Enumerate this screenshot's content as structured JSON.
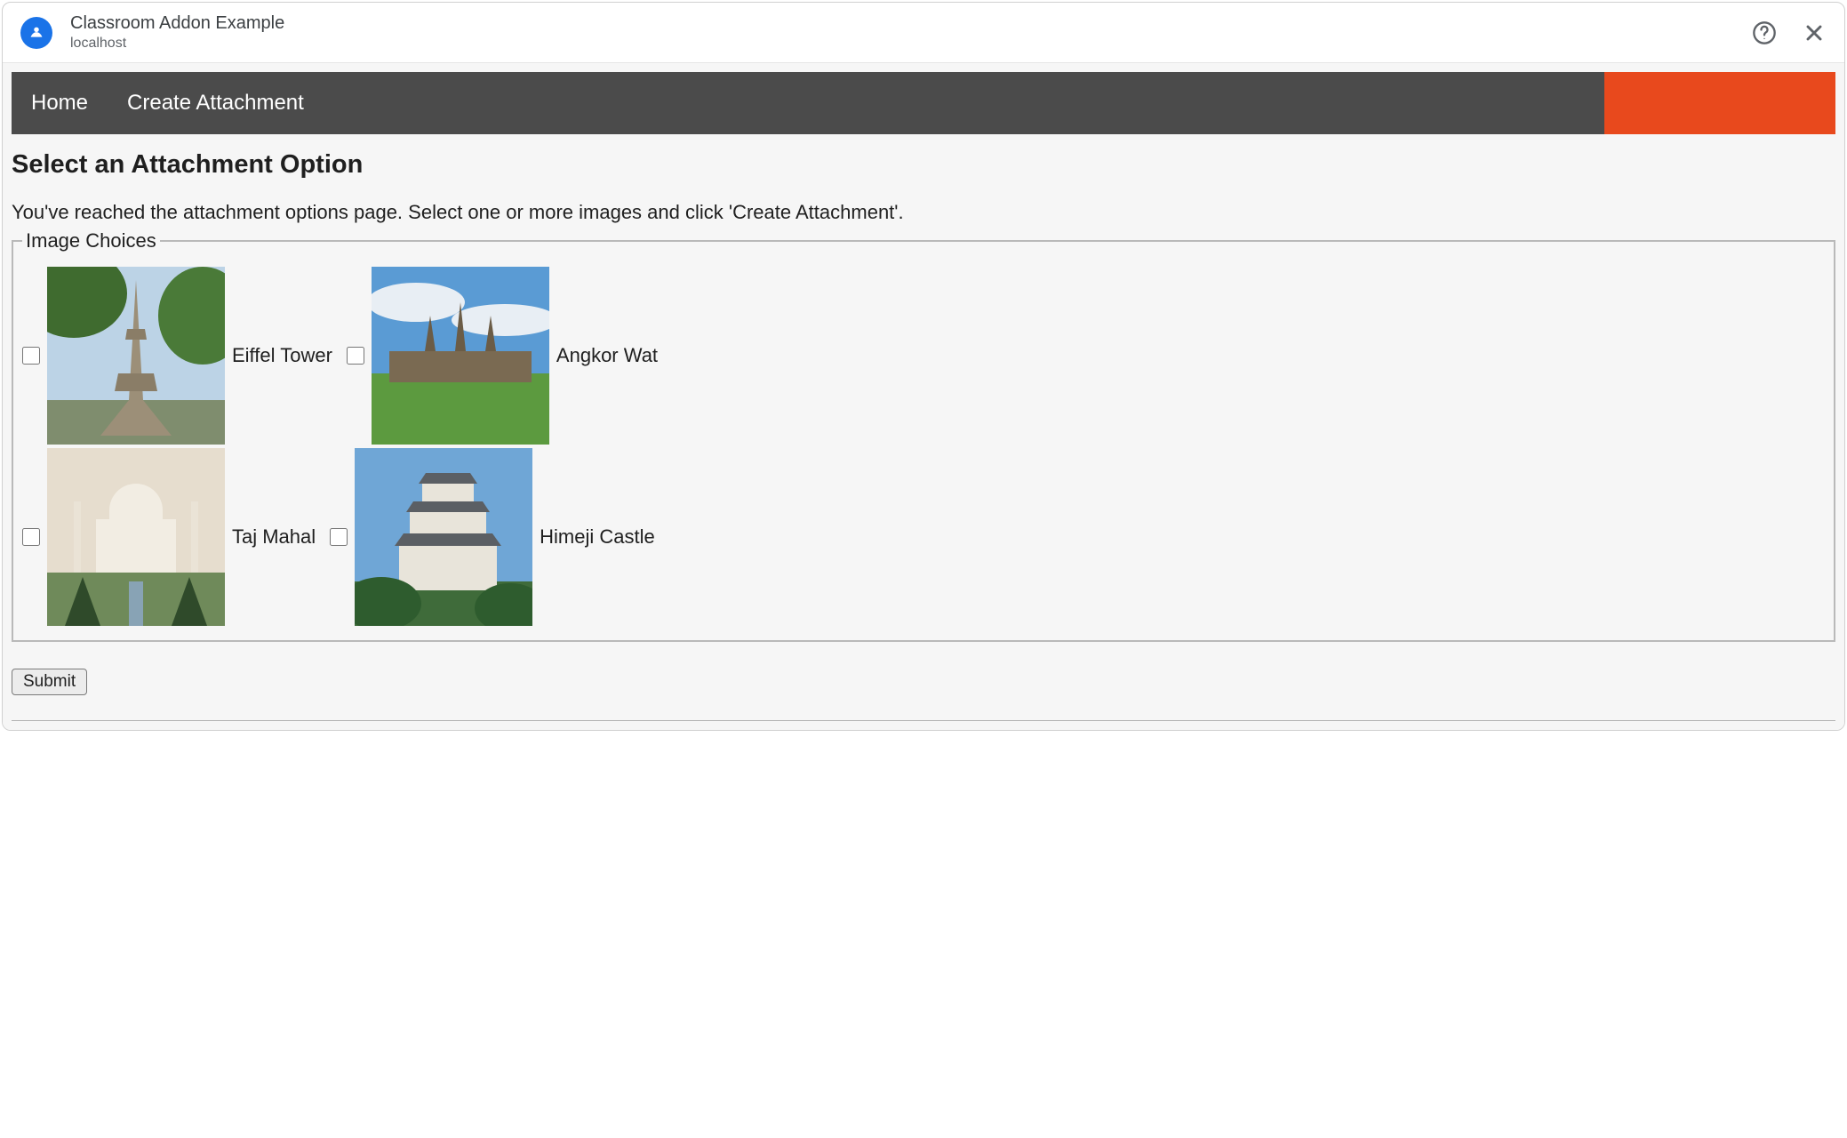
{
  "dialog": {
    "title": "Classroom Addon Example",
    "subtitle": "localhost"
  },
  "navbar": {
    "items": [
      {
        "label": "Home"
      },
      {
        "label": "Create Attachment"
      }
    ]
  },
  "page": {
    "heading": "Select an Attachment Option",
    "description": "You've reached the attachment options page. Select one or more images and click 'Create Attachment'.",
    "fieldset_legend": "Image Choices",
    "choices": [
      {
        "label": "Eiffel Tower"
      },
      {
        "label": "Angkor Wat"
      },
      {
        "label": "Taj Mahal"
      },
      {
        "label": "Himeji Castle"
      }
    ],
    "submit_label": "Submit"
  }
}
